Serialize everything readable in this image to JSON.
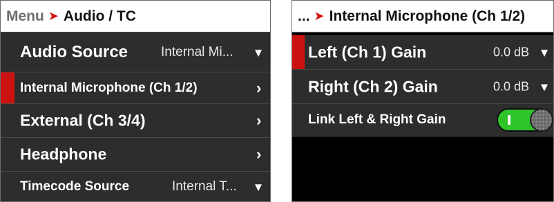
{
  "left": {
    "header": {
      "menu": "Menu",
      "arrow_icon": "red-arrow-right-icon",
      "title": "Audio / TC"
    },
    "rows": [
      {
        "label": "Audio Source",
        "value": "Internal Mi...",
        "chevron": "⌄",
        "selected": false
      },
      {
        "label": "Internal Microphone (Ch 1/2)",
        "value": "",
        "chevron": "›",
        "selected": true
      },
      {
        "label": "External (Ch 3/4)",
        "value": "",
        "chevron": "›",
        "selected": false
      },
      {
        "label": "Headphone",
        "value": "",
        "chevron": "›",
        "selected": false
      },
      {
        "label": "Timecode Source",
        "value": "Internal T...",
        "chevron": "⌄",
        "selected": false
      }
    ]
  },
  "right": {
    "header": {
      "menu": "...",
      "arrow_icon": "red-arrow-right-icon",
      "title": "Internal Microphone (Ch 1/2)"
    },
    "rows": [
      {
        "label": "Left (Ch 1) Gain",
        "value": "0.0 dB",
        "chevron": "⌄",
        "selected": true
      },
      {
        "label": "Right (Ch 2) Gain",
        "value": "0.0 dB",
        "chevron": "⌄",
        "selected": false
      },
      {
        "label": "Link Left & Right Gain",
        "toggle_on": true,
        "selected": false
      }
    ]
  },
  "colors": {
    "accent_red": "#cc1111",
    "toggle_green": "#2ec52b",
    "row_bg": "#2d2d2d",
    "panel_bg": "#000000"
  }
}
